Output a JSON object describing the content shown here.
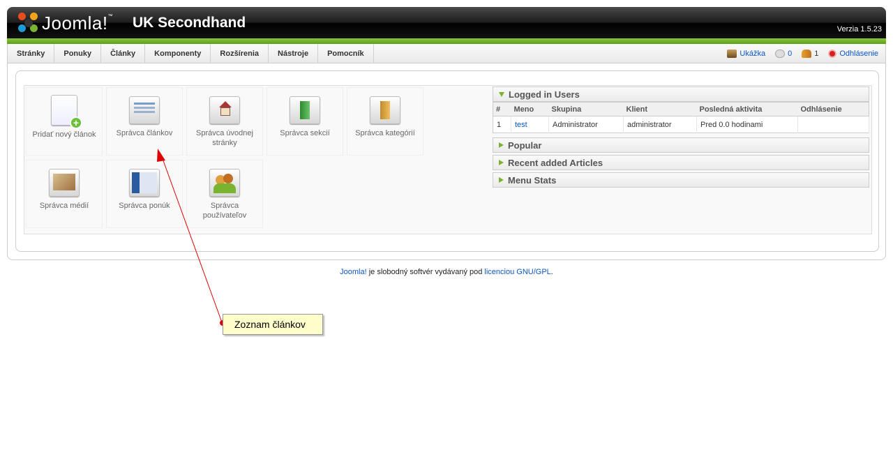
{
  "header": {
    "logo_text": "Joomla!",
    "site_name": "UK Secondhand",
    "version": "Verzia 1.5.23"
  },
  "menu": [
    "Stránky",
    "Ponuky",
    "Články",
    "Komponenty",
    "Rozšírenia",
    "Nástroje",
    "Pomocník"
  ],
  "status": {
    "preview": "Ukážka",
    "messages": "0",
    "users_online": "1",
    "logout": "Odhlásenie"
  },
  "cpanel": [
    {
      "label": "Pridať nový článok",
      "icon": "add-article-icon"
    },
    {
      "label": "Správca článkov",
      "icon": "article-manager-icon"
    },
    {
      "label": "Správca úvodnej stránky",
      "icon": "frontpage-manager-icon"
    },
    {
      "label": "Správca sekcií",
      "icon": "section-manager-icon"
    },
    {
      "label": "Správca kategórií",
      "icon": "category-manager-icon"
    },
    {
      "label": "Správca médií",
      "icon": "media-manager-icon"
    },
    {
      "label": "Správca ponúk",
      "icon": "menu-manager-icon"
    },
    {
      "label": "Správca používateľov",
      "icon": "user-manager-icon"
    }
  ],
  "logged_in": {
    "title": "Logged in Users",
    "columns": [
      "#",
      "Meno",
      "Skupina",
      "Klient",
      "Posledná aktivita",
      "Odhlásenie"
    ],
    "rows": [
      {
        "num": "1",
        "name": "test",
        "group": "Administrator",
        "client": "administrator",
        "last": "Pred 0.0 hodinami",
        "logout": ""
      }
    ]
  },
  "sections": [
    "Popular",
    "Recent added Articles",
    "Menu Stats"
  ],
  "footer": {
    "link1": "Joomla!",
    "text": " je slobodný softvér vydávaný pod ",
    "link2": "licenciou GNU/GPL",
    "end": "."
  },
  "annotation": {
    "text": "Zoznam článkov"
  },
  "colors": {
    "accent_green": "#7ab32e",
    "link_blue": "#0B55C4",
    "arrow_red": "#e00000"
  }
}
